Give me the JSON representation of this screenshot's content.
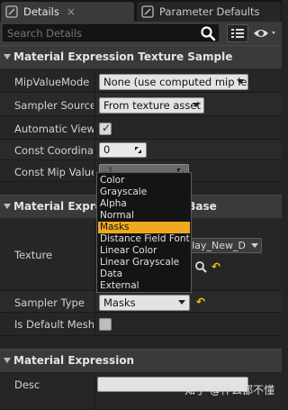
{
  "tabs": [
    {
      "label": "Details",
      "icon": "details-icon",
      "close": "×"
    },
    {
      "label": "Parameter Defaults",
      "icon": "parameter-defaults-icon"
    }
  ],
  "search": {
    "placeholder": "Search Details"
  },
  "categories": [
    {
      "label": "Material Expression Texture Sample"
    },
    {
      "label": "Material Expression Texture Base"
    },
    {
      "label": "Material Expression"
    }
  ],
  "properties": {
    "mip_value_mode": {
      "label": "MipValueMode",
      "value": "None (use computed mip level)"
    },
    "sampler_source": {
      "label": "Sampler Source",
      "value": "From texture asset"
    },
    "automatic_view_mip_bias": {
      "label": "Automatic View Mip Bias",
      "checked": true
    },
    "const_coordinate": {
      "label": "Const Coordinate",
      "value": "0"
    },
    "const_mip_value": {
      "label": "Const Mip Value",
      "value": "-1"
    },
    "texture": {
      "label": "Texture",
      "asset_name": "T_Brick_Clay_New_D"
    },
    "sampler_type": {
      "label": "Sampler Type",
      "value": "Masks",
      "reset_icon": "reset-arrow-icon"
    },
    "is_default_meshpaint_texture": {
      "label": "Is Default Meshpaint Texture",
      "checked": false
    },
    "desc": {
      "label": "Desc",
      "value": ""
    }
  },
  "dropdown": {
    "items": [
      "Color",
      "Grayscale",
      "Alpha",
      "Normal",
      "Masks",
      "Distance Field Font",
      "Linear Color",
      "Linear Grayscale",
      "Data",
      "External"
    ],
    "selected": "Masks"
  },
  "watermark": "知乎 @什么都不懂",
  "colors": {
    "background": "#242424",
    "category_bg": "#3a3a3a",
    "selected_item": "#f0a91e",
    "reset_arrow": "#f0c419"
  }
}
